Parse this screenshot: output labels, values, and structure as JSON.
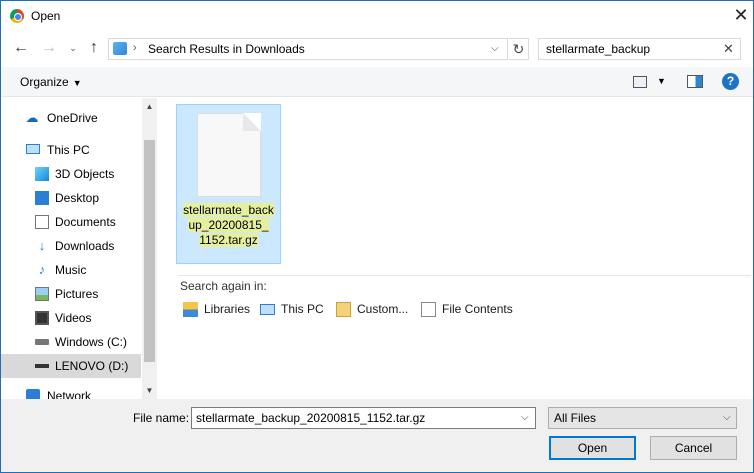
{
  "window": {
    "title": "Open",
    "close": "✕"
  },
  "nav": {
    "back": "←",
    "forward": "→",
    "recent": "⌄",
    "up": "↑",
    "address_separator": "›",
    "address": "Search Results in Downloads",
    "address_dropdown": "⌵",
    "refresh": "↻"
  },
  "search": {
    "value": "stellarmate_backup",
    "clear": "✕"
  },
  "toolbar": {
    "organize": "Organize",
    "organize_caret": "▼",
    "view_caret": "▼",
    "help": "?"
  },
  "sidebar": {
    "items": [
      {
        "label": "OneDrive",
        "icon": "cloud-icon"
      },
      {
        "label": "This PC",
        "icon": "computer-icon"
      },
      {
        "label": "3D Objects",
        "icon": "3d-objects-icon"
      },
      {
        "label": "Desktop",
        "icon": "desktop-icon"
      },
      {
        "label": "Documents",
        "icon": "documents-icon"
      },
      {
        "label": "Downloads",
        "icon": "downloads-icon"
      },
      {
        "label": "Music",
        "icon": "music-icon"
      },
      {
        "label": "Pictures",
        "icon": "pictures-icon"
      },
      {
        "label": "Videos",
        "icon": "videos-icon"
      },
      {
        "label": "Windows (C:)",
        "icon": "drive-icon"
      },
      {
        "label": "LENOVO (D:)",
        "icon": "drive-icon",
        "selected": true
      },
      {
        "label": "Network",
        "icon": "network-icon"
      }
    ],
    "scroll_up": "▲",
    "scroll_down": "▼"
  },
  "results": {
    "file": {
      "name": "stellarmate_backup_20200815_1152.tar.gz",
      "lines": [
        "stellarmate_back",
        "up_20200815_",
        "1152.tar.gz"
      ]
    },
    "search_again_label": "Search again in:",
    "search_again": [
      {
        "label": "Libraries",
        "icon": "libraries-icon"
      },
      {
        "label": "This PC",
        "icon": "computer-icon"
      },
      {
        "label": "Custom...",
        "icon": "custom-folder-icon"
      },
      {
        "label": "File Contents",
        "icon": "file-contents-icon"
      }
    ]
  },
  "footer": {
    "file_name_label": "File name:",
    "file_name_value": "stellarmate_backup_20200815_1152.tar.gz",
    "file_name_dropdown": "⌵",
    "filter": "All Files",
    "filter_caret": "⌵",
    "open": "Open",
    "cancel": "Cancel"
  },
  "colors": {
    "accent": "#0078d7",
    "selection": "#cce8ff",
    "highlight": "#e6ef9e"
  }
}
